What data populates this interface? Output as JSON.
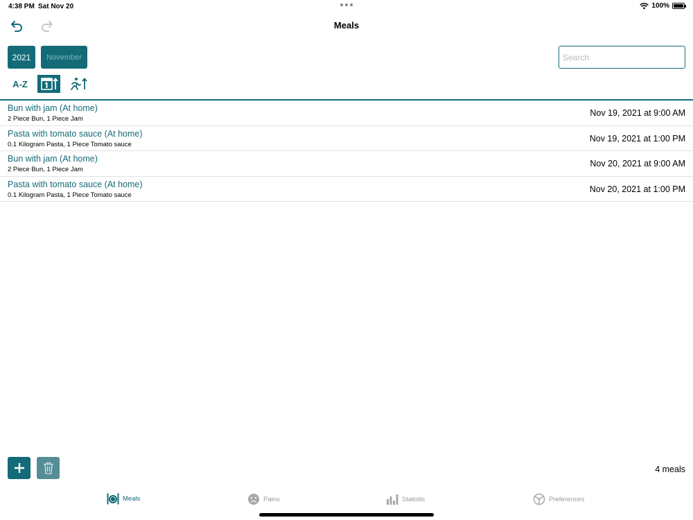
{
  "status": {
    "time": "4:38 PM",
    "date": "Sat Nov 20",
    "battery": "100%"
  },
  "nav": {
    "title": "Meals",
    "undo_icon": "undo-icon",
    "redo_icon": "redo-icon"
  },
  "filters": {
    "year": "2021",
    "month": "November",
    "search_placeholder": "Search"
  },
  "sort": {
    "az_label": "A-Z",
    "date_icon": "calendar-sort-icon",
    "activity_icon": "activity-sort-icon"
  },
  "meals": [
    {
      "title": "Bun with jam (At home)",
      "detail": "2 Piece Bun, 1 Piece Jam",
      "date": "Nov 19, 2021 at 9:00 AM"
    },
    {
      "title": "Pasta with tomato sauce (At home)",
      "detail": "0.1 Kilogram Pasta, 1 Piece Tomato sauce",
      "date": "Nov 19, 2021 at 1:00 PM"
    },
    {
      "title": "Bun with jam (At home)",
      "detail": "2 Piece Bun, 1 Piece Jam",
      "date": "Nov 20, 2021 at 9:00 AM"
    },
    {
      "title": "Pasta with tomato sauce (At home)",
      "detail": "0.1 Kilogram Pasta, 1 Piece Tomato sauce",
      "date": "Nov 20, 2021 at 1:00 PM"
    }
  ],
  "footer": {
    "count": "4 meals",
    "add_icon": "plus-icon",
    "delete_icon": "trash-icon"
  },
  "tabs": {
    "meals": "Meals",
    "pains": "Pains",
    "statistic": "Statistic",
    "preferences": "Preferences"
  },
  "colors": {
    "accent": "#146b78",
    "inactive": "#9a9a9a",
    "divider": "#e1e1e1"
  }
}
